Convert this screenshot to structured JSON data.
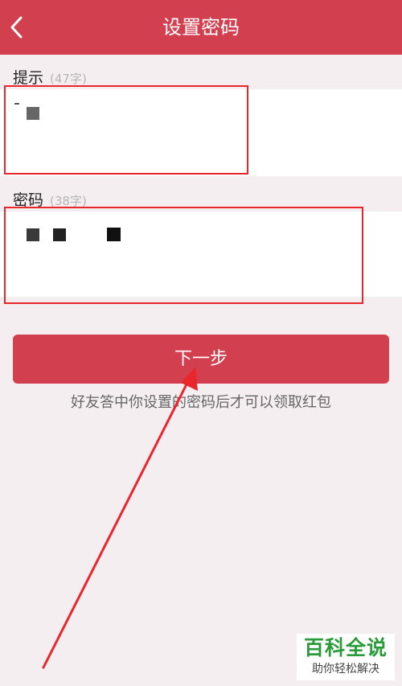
{
  "header": {
    "title": "设置密码",
    "back_icon": "chevron-left-icon"
  },
  "hint_field": {
    "label": "提示",
    "count": "(47字)"
  },
  "password_field": {
    "label": "密码",
    "count": "(38字)"
  },
  "next_button": {
    "label": "下一步"
  },
  "helper_text": "好友答中你设置的密码后才可以领取红包",
  "watermark": {
    "title": "百科全说",
    "subtitle": "助你轻松解决"
  },
  "colors": {
    "accent": "#d23f4f",
    "background": "#f5eef0",
    "annotation": "#e8262b",
    "watermark": "#2a9b3a"
  }
}
